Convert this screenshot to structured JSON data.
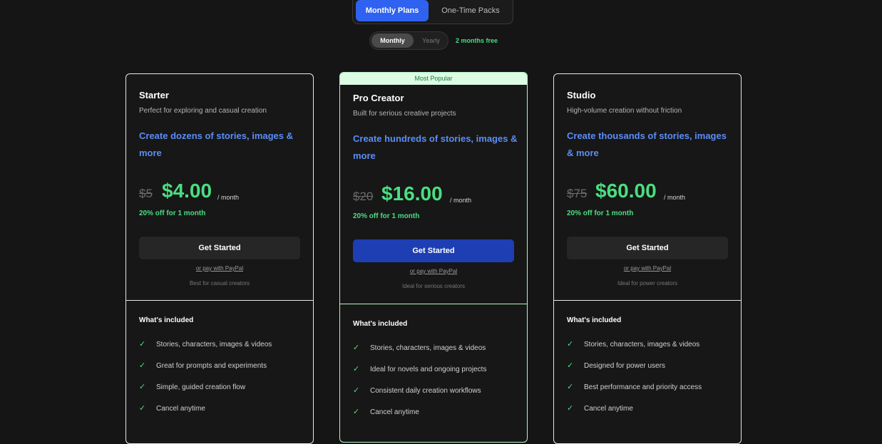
{
  "plan_tabs": {
    "active": "Monthly Plans",
    "inactive": "One-Time Packs"
  },
  "billing_toggle": {
    "on": "Monthly",
    "off": "Yearly",
    "promo": "2 months free"
  },
  "check_icon": "✓",
  "plans": [
    {
      "badge": "",
      "name": "Starter",
      "description": "Perfect for exploring and casual creation",
      "headline": "Create dozens of stories, images & more",
      "old_price": "$5",
      "price": "$4.00",
      "period": "/ month",
      "discount": "20% off for 1 month",
      "cta": "Get Started",
      "paypal": "or pay with PayPal",
      "best_for": "Best for casual creators",
      "included_title": "What's included",
      "features": [
        "Stories, characters, images & videos",
        "Great for prompts and experiments",
        "Simple, guided creation flow",
        "Cancel anytime"
      ]
    },
    {
      "badge": "Most Popular",
      "name": "Pro Creator",
      "description": "Built for serious creative projects",
      "headline": "Create hundreds of stories, images & more",
      "old_price": "$20",
      "price": "$16.00",
      "period": "/ month",
      "discount": "20% off for 1 month",
      "cta": "Get Started",
      "paypal": "or pay with PayPal",
      "best_for": "Ideal for serious creators",
      "included_title": "What's included",
      "features": [
        "Stories, characters, images & videos",
        "Ideal for novels and ongoing projects",
        "Consistent daily creation workflows",
        "Cancel anytime"
      ]
    },
    {
      "badge": "",
      "name": "Studio",
      "description": "High-volume creation without friction",
      "headline": "Create thousands of stories, images & more",
      "old_price": "$75",
      "price": "$60.00",
      "period": "/ month",
      "discount": "20% off for 1 month",
      "cta": "Get Started",
      "paypal": "or pay with PayPal",
      "best_for": "Ideal for power creators",
      "included_title": "What's included",
      "features": [
        "Stories, characters, images & videos",
        "Designed for power users",
        "Best performance and priority access",
        "Cancel anytime"
      ]
    }
  ],
  "colors": {
    "background": "#151515",
    "accent_blue": "#2f62f0",
    "headline_blue": "#5b8df7",
    "price_green": "#4ade80",
    "pro_cta": "#1e3fb3",
    "popular_banner": "#dcfce4"
  }
}
